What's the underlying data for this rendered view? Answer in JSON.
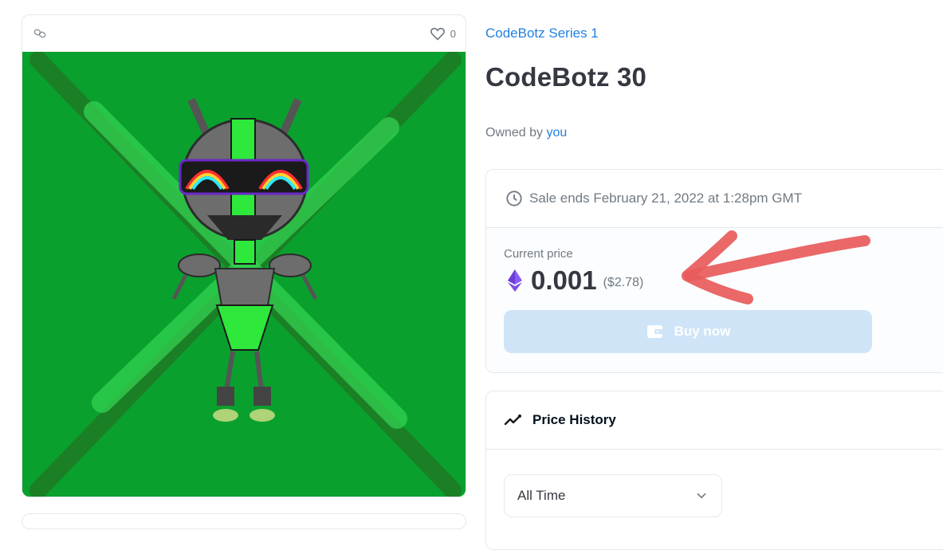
{
  "asset": {
    "favorite_count": "0"
  },
  "collection": {
    "name": "CodeBotz Series 1"
  },
  "item": {
    "title": "CodeBotz 30",
    "owner_prefix": "Owned by",
    "owner_link": "you"
  },
  "sale": {
    "ends_text": "Sale ends February 21, 2022 at 1:28pm GMT",
    "current_price_label": "Current price",
    "price": "0.001",
    "price_usd": "($2.78)",
    "buy_label": "Buy now",
    "buy_button_color": "#cfe4f7"
  },
  "price_history": {
    "title": "Price History",
    "range_selected": "All Time"
  },
  "colors": {
    "link": "#2081e2",
    "art_background": "#0aa02e",
    "annotation_arrow": "#e85b5b"
  },
  "icons": [
    "chain-icon",
    "heart-icon",
    "clock-icon",
    "ethereum-icon",
    "wallet-icon",
    "trend-icon",
    "chevron-down-icon"
  ]
}
